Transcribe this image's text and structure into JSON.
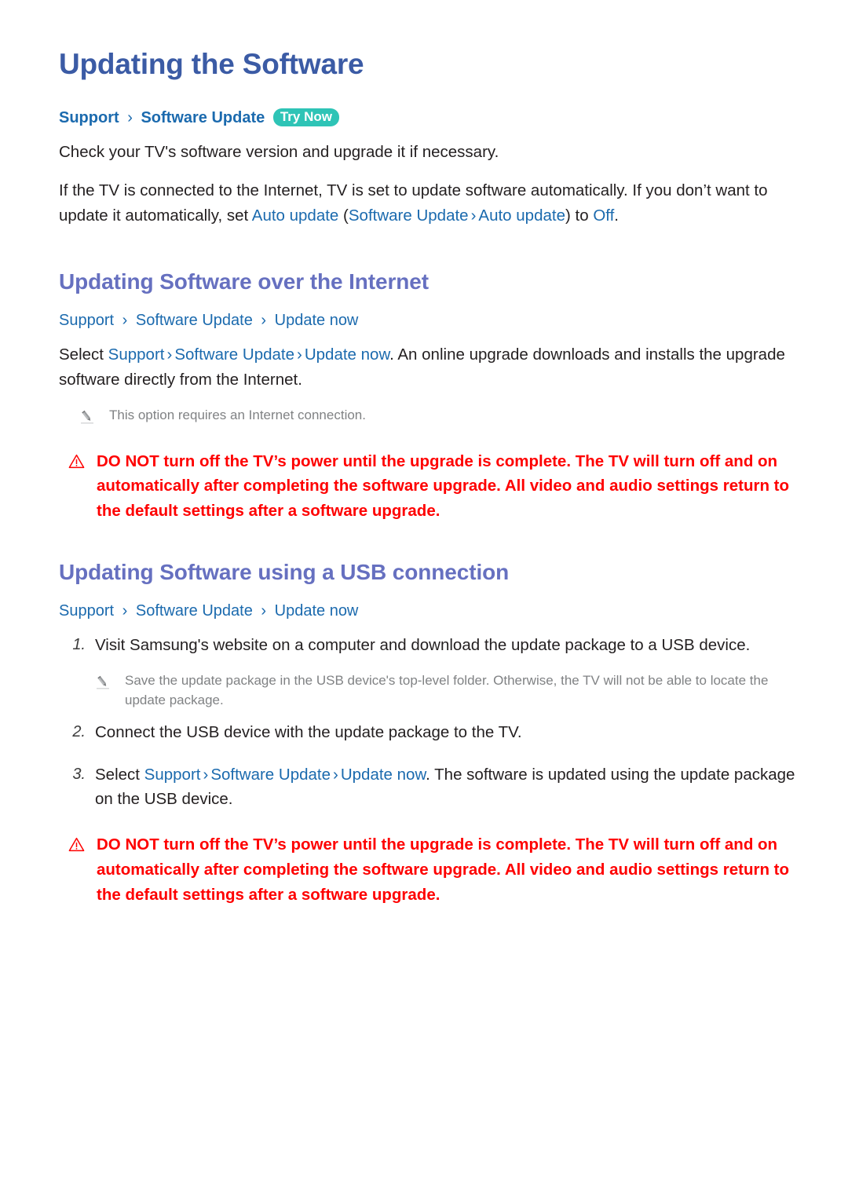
{
  "page": {
    "title": "Updating the Software"
  },
  "intro": {
    "breadcrumb": {
      "crumbs": [
        "Support",
        "Software Update"
      ],
      "separator": "›",
      "try_now_label": "Try Now",
      "try_now_color": "#2ec4b6"
    },
    "paragraph_1": "Check your TV's software version and upgrade it if necessary.",
    "paragraph_2": {
      "part_1": "If the TV is connected to the Internet, TV is set to update software automatically. If you don’t want to update it automatically, set ",
      "link_1": "Auto update",
      "open_paren": " (",
      "link_2": "Software Update",
      "separator": "›",
      "link_3": "Auto update",
      "close_paren": ") to ",
      "link_4": "Off",
      "part_end": "."
    }
  },
  "section_internet": {
    "heading": "Updating Software over the Internet",
    "breadcrumb": {
      "crumbs": [
        "Support",
        "Software Update",
        "Update now"
      ],
      "separator": "›"
    },
    "paragraph": {
      "lead": "Select ",
      "link_1": "Support",
      "separator": "›",
      "link_2": "Software Update",
      "link_3": "Update now",
      "tail": ". An online upgrade downloads and installs the upgrade software directly from the Internet."
    },
    "note": {
      "icon": "pencil-icon",
      "text": "This option requires an Internet connection."
    },
    "warning": {
      "icon": "warning-triangle-icon",
      "color": "#fe0000",
      "text": "DO NOT turn off the TV’s power until the upgrade is complete. The TV will turn off and on automatically after completing the software upgrade. All video and audio settings return to the default settings after a software upgrade."
    }
  },
  "section_usb": {
    "heading": "Updating Software using a USB connection",
    "breadcrumb": {
      "crumbs": [
        "Support",
        "Software Update",
        "Update now"
      ],
      "separator": "›"
    },
    "steps": [
      {
        "number": "1.",
        "text": "Visit Samsung's website on a computer and download the update package to a USB device."
      },
      {
        "number": "2.",
        "text": "Connect the USB device with the update package to the TV."
      }
    ],
    "step_note": {
      "icon": "pencil-icon",
      "text": "Save the update package in the USB device's top-level folder. Otherwise, the TV will not be able to locate the update package."
    },
    "step_3": {
      "number": "3.",
      "lead": "Select ",
      "link_1": "Support",
      "separator": "›",
      "link_2": "Software Update",
      "link_3": "Update now",
      "tail": ". The software is updated using the update package on the USB device."
    },
    "warning": {
      "icon": "warning-triangle-icon",
      "color": "#fe0000",
      "text": "DO NOT turn off the TV’s power until the upgrade is complete. The TV will turn off and on automatically after completing the software upgrade. All video and audio settings return to the default settings after a software upgrade."
    }
  },
  "colors": {
    "title_blue": "#3b5ba5",
    "section_purple": "#6670c0",
    "link_blue": "#1b6aae",
    "body_text": "#231f20",
    "note_gray": "#808284",
    "warning_red": "#fe0000",
    "badge_teal": "#2ec4b6"
  }
}
